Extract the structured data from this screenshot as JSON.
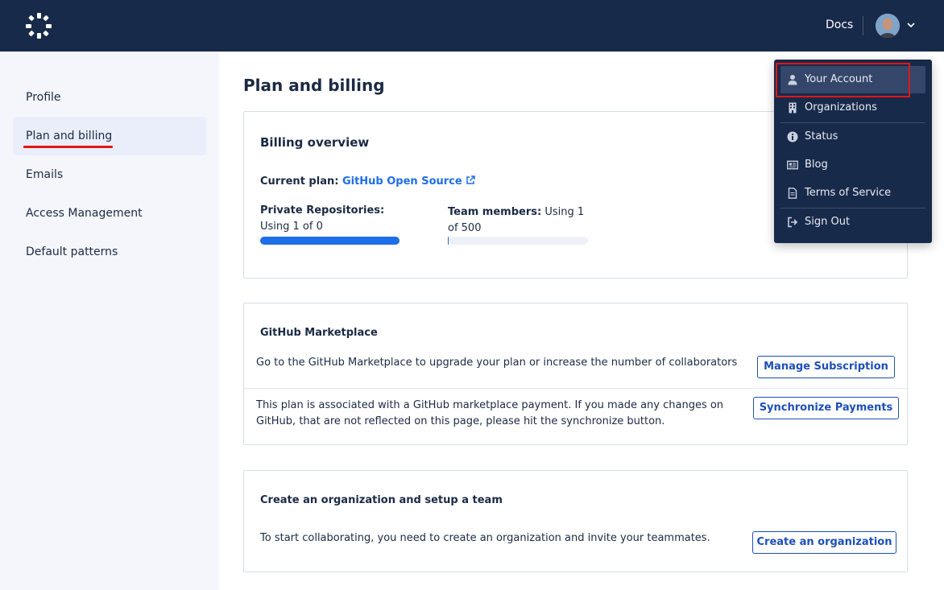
{
  "header": {
    "docs_label": "Docs"
  },
  "sidebar": {
    "items": [
      {
        "label": "Profile"
      },
      {
        "label": "Plan and billing",
        "active": true
      },
      {
        "label": "Emails"
      },
      {
        "label": "Access Management"
      },
      {
        "label": "Default patterns"
      }
    ]
  },
  "page": {
    "title": "Plan and billing"
  },
  "billing": {
    "heading": "Billing overview",
    "current_plan_label": "Current plan:",
    "current_plan_value": "GitHub Open Source",
    "private_repos_label": "Private Repositories:",
    "private_repos_usage": "Using 1 of 0",
    "private_repos_progress": 1.0,
    "team_members_label": "Team members:",
    "team_members_usage": "Using 1 of 500",
    "team_members_progress": 0.002
  },
  "marketplace": {
    "heading": "GitHub Marketplace",
    "manage_text": "Go to the GitHub Marketplace to upgrade your plan or increase the number of collaborators",
    "manage_button": "Manage Subscription",
    "sync_text": "This plan is associated with a GitHub marketplace payment. If you made any changes on GitHub, that are not reflected on this page, please hit the synchronize button.",
    "sync_button": "Synchronize Payments"
  },
  "organization": {
    "heading": "Create an organization and setup a team",
    "text": "To start collaborating, you need to create an organization and invite your teammates.",
    "button": "Create an organization"
  },
  "dropdown": {
    "items": [
      {
        "label": "Your Account",
        "icon": "user-icon",
        "highlighted": true
      },
      {
        "label": "Organizations",
        "icon": "building-icon"
      },
      {
        "label": "Status",
        "icon": "info-icon"
      },
      {
        "label": "Blog",
        "icon": "newspaper-icon"
      },
      {
        "label": "Terms of Service",
        "icon": "document-icon"
      },
      {
        "label": "Sign Out",
        "icon": "sign-out-icon"
      }
    ]
  },
  "colors": {
    "accent": "#1e6ee8",
    "nav": "#182a4a",
    "annotation": "#e11616"
  }
}
